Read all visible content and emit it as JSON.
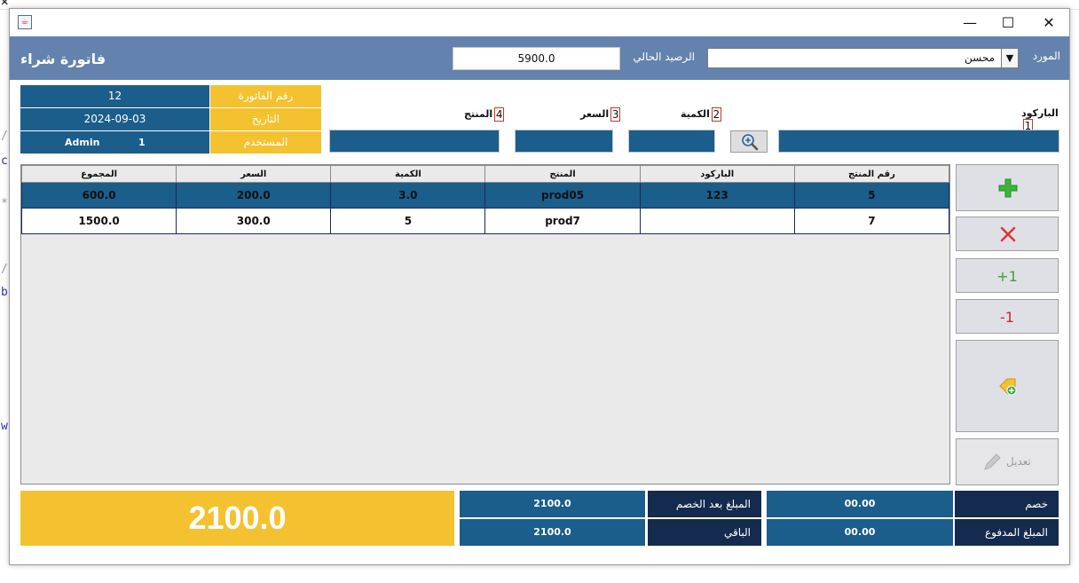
{
  "background": {
    "chars": [
      "/",
      "c",
      "*",
      "/",
      "b",
      "w"
    ]
  },
  "window": {
    "close_symbol": "✕",
    "minimize_symbol": "—",
    "maximize_symbol": "☐",
    "app_icon_symbol": "☕"
  },
  "header": {
    "title": "فاتورة شراء",
    "balance_label": "الرصيد الحالي",
    "balance_value": "5900.0",
    "supplier_label": "المورد",
    "supplier_value": "محسن"
  },
  "invoice_info": [
    {
      "label": "رقم الفاتورة",
      "value": "12"
    },
    {
      "label": "التاريخ",
      "value": "2024-09-03"
    },
    {
      "label": "المستخدم",
      "value_name": "Admin",
      "value_id": "1"
    }
  ],
  "entry_fields": [
    {
      "num": "1",
      "label": "الباركود"
    },
    {
      "num": "2",
      "label": "الكمية"
    },
    {
      "num": "3",
      "label": "السعر"
    },
    {
      "num": "4",
      "label": "المنتج"
    }
  ],
  "table": {
    "columns": [
      "المجموع",
      "السعر",
      "الكمية",
      "المنتج",
      "الباركود",
      "رقم المنتج"
    ],
    "rows": [
      [
        "600.0",
        "200.0",
        "3.0",
        "prod05",
        "123",
        "5"
      ],
      [
        "1500.0",
        "300.0",
        "5",
        "prod7",
        "",
        "7"
      ]
    ]
  },
  "side_buttons": {
    "plus_one": "+1",
    "minus_one": "-1",
    "edit_label": "تعديل"
  },
  "totals": {
    "grand_total": "2100.0",
    "discount_label": "خصم",
    "discount_value": "00.00",
    "after_discount_label": "المبلغ بعد الخصم",
    "after_discount_value": "2100.0",
    "paid_label": "المبلغ المدفوع",
    "paid_value": "00.00",
    "remaining_label": "الباقي",
    "remaining_value": "2100.0"
  },
  "colors": {
    "header": "#6383ae",
    "field_blue": "#1b5d8b",
    "accent_yellow": "#f4c230",
    "dark_navy": "#142a4e"
  }
}
